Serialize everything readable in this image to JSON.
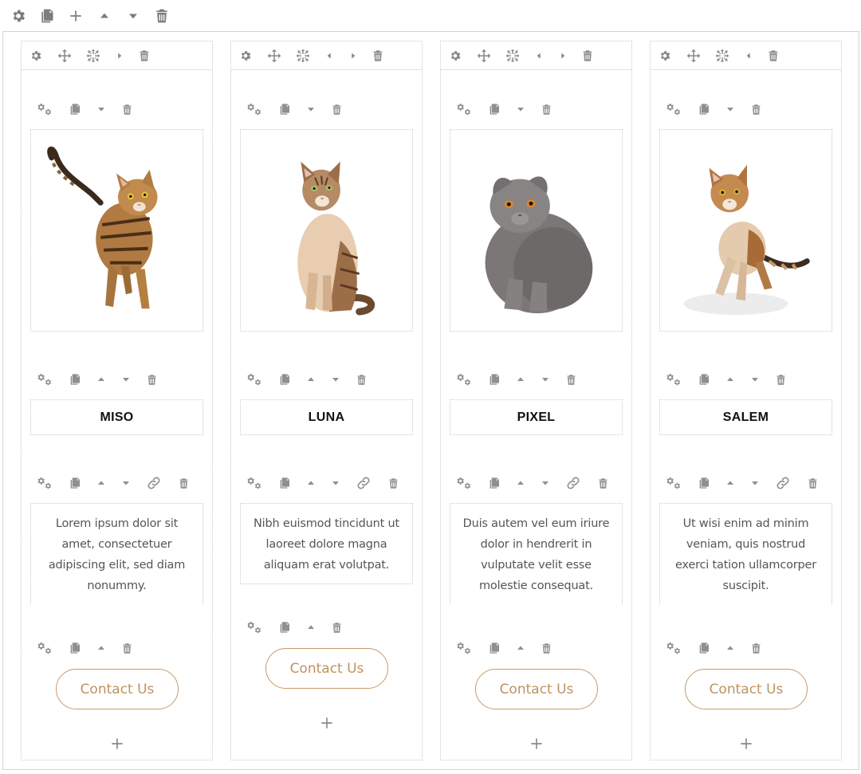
{
  "toolbar": {
    "icons": [
      "gear-icon",
      "copy-icon",
      "plus-icon",
      "chevron-up-icon",
      "chevron-down-icon",
      "trash-icon"
    ]
  },
  "accent_color": "#c49a6c",
  "cards": [
    {
      "name": "MISO",
      "text": "Lorem ipsum dolor sit amet, consectetuer adipiscing elit, sed diam nonummy.",
      "button": "Contact Us",
      "image": "tabby-cat-walking"
    },
    {
      "name": "LUNA",
      "text": "Nibh euismod tincidunt ut laoreet dolore magna aliquam erat volutpat.",
      "button": "Contact Us",
      "image": "siamese-tabby-cat-sitting"
    },
    {
      "name": "PIXEL",
      "text": "Duis autem vel eum iriure dolor in hendrerit in vulputate velit esse molestie consequat.",
      "button": "Contact Us",
      "image": "grey-scottish-fold-cat"
    },
    {
      "name": "SALEM",
      "text": "Ut wisi enim ad minim veniam, quis nostrud exerci tation ullamcorper suscipit.",
      "button": "Contact Us",
      "image": "calico-kitten-standing"
    }
  ]
}
